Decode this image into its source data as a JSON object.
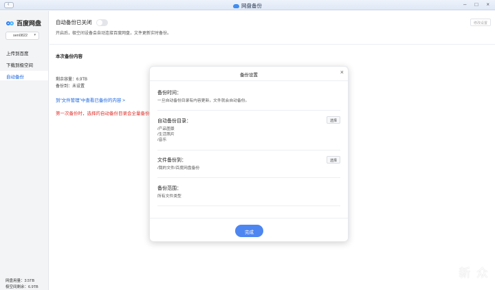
{
  "window": {
    "title": "网盘备份"
  },
  "sidebar": {
    "logo": "百度网盘",
    "user": "sen0822",
    "items": [
      {
        "label": "上传到百度"
      },
      {
        "label": "下载到极空间"
      },
      {
        "label": "自动备份"
      }
    ],
    "quota": [
      "网盘用量：3.5TB",
      "极空间剩余：6.9TB"
    ]
  },
  "main": {
    "toggle_label": "自动备份已关闭",
    "description": "开启后，极空间设备会自动连接百度网盘，文件更新实时备份。",
    "edit_button": "修改设置",
    "section_title": "本次备份内容",
    "remaining": "剩余容量：6.9TB",
    "backup_to": "备份到：未设置",
    "link": "到“文件管理”中查看已备份的内容 >",
    "warning": "第一次备份时，选择的自动备份目录会全量备份"
  },
  "modal": {
    "title": "备份设置",
    "time_label": "备份时间：",
    "time_desc": "一旦自动备份目录有内容更新，文件就会自动备份。",
    "dir_label": "自动备份目录：",
    "dirs": [
      "/产品图景",
      "/生活照片",
      "/音乐"
    ],
    "choose_label": "选择",
    "dest_label": "文件备份到：",
    "dest_path": "/我的文件/百度网盘备份",
    "scope_label": "备份范围：",
    "scope_value": "所有文件类型",
    "done_label": "完成"
  },
  "watermark": "新 众"
}
